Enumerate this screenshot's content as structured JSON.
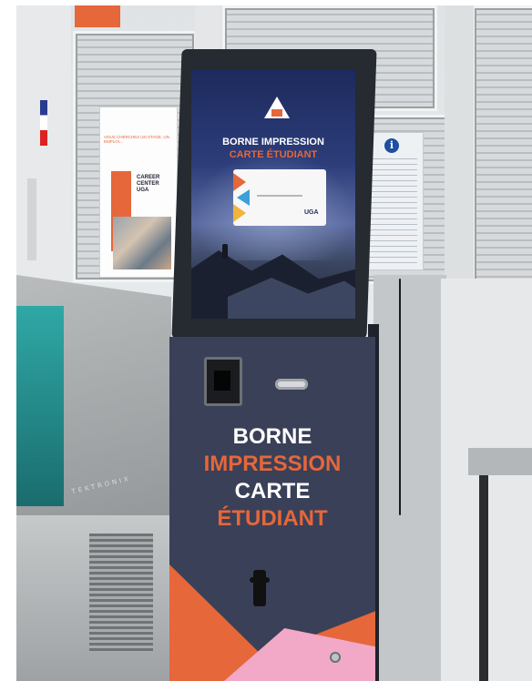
{
  "scene": {
    "description_colors": {
      "accent_orange": "#e5673a",
      "kiosk_navy": "#3a4058",
      "screen_blue": "#2c3d7a"
    }
  },
  "screen": {
    "title_line1": "BORNE IMPRESSION",
    "title_line2": "CARTE ÉTUDIANT",
    "card_logo": "UGA"
  },
  "kiosk_body": {
    "line1": "BORNE",
    "line2": "IMPRESSION",
    "line3": "CARTE",
    "line4": "ÉTUDIANT"
  },
  "poster": {
    "text": "VOUS CHERCHEZ UN STAGE, UN EMPLOI...",
    "brand_line1": "CAREER",
    "brand_line2": "CENTER",
    "brand_line3": "UGA"
  },
  "info_sign": {
    "icon": "i"
  },
  "left_terminal": {
    "brand": "TEKTRONIX"
  }
}
